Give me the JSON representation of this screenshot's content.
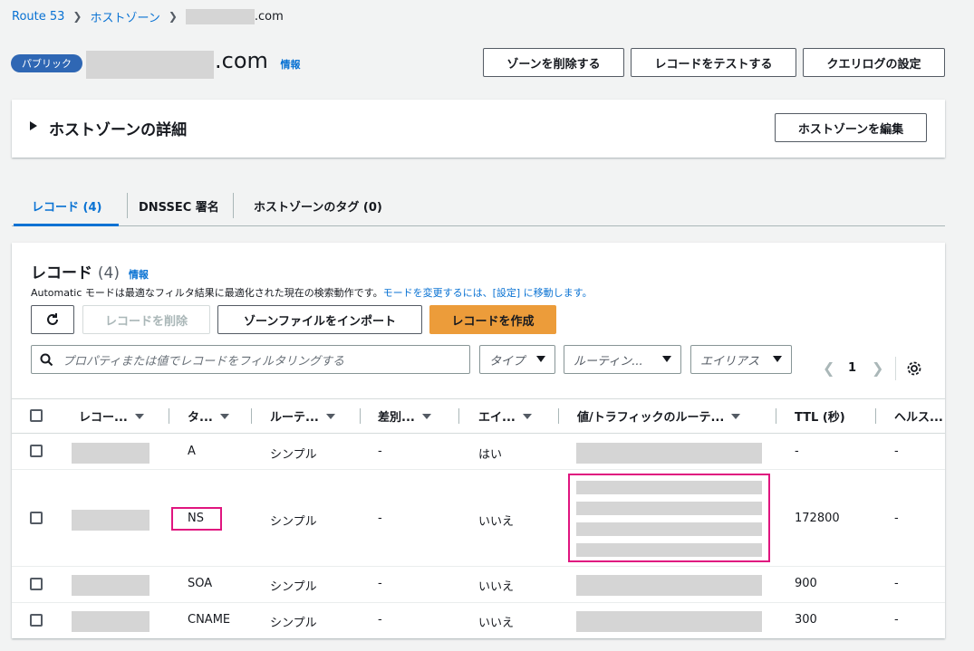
{
  "breadcrumb": {
    "root": "Route 53",
    "zones": "ホストゾーン",
    "current_suffix": ".com"
  },
  "header": {
    "badge": "パブリック",
    "title_suffix": ".com",
    "info": "情報",
    "buttons": {
      "delete_zone": "ゾーンを削除する",
      "test_record": "レコードをテストする",
      "query_log": "クエリログの設定"
    }
  },
  "details": {
    "title": "ホストゾーンの詳細",
    "edit_button": "ホストゾーンを編集"
  },
  "tabs": [
    {
      "label": "レコード (4)",
      "active": true
    },
    {
      "label": "DNSSEC 署名",
      "active": false
    },
    {
      "label": "ホストゾーンのタグ (0)",
      "active": false
    }
  ],
  "records": {
    "title": "レコード",
    "count": "(4)",
    "info": "情報",
    "hint_text": "Automatic モードは最適なフィルタ結果に最適化された現在の検索動作です。",
    "hint_link": "モードを変更するには、[設定] に移動します。",
    "buttons": {
      "delete": "レコードを削除",
      "import": "ゾーンファイルをインポート",
      "create": "レコードを作成"
    },
    "search_placeholder": "プロパティまたは値でレコードをフィルタリングする",
    "filters": {
      "type": "タイプ",
      "routing": "ルーティン...",
      "alias": "エイリアス"
    },
    "page": "1",
    "columns": [
      "レコー...",
      "タ...",
      "ルーテ...",
      "差別...",
      "エイ...",
      "値/トラフィックのルーテ...",
      "TTL (秒)",
      "ヘルス..."
    ],
    "rows": [
      {
        "type": "A",
        "routing": "シンプル",
        "diff": "-",
        "alias": "はい",
        "ttl": "-",
        "health": "-"
      },
      {
        "type": "NS",
        "routing": "シンプル",
        "diff": "-",
        "alias": "いいえ",
        "ttl": "172800",
        "health": "-"
      },
      {
        "type": "SOA",
        "routing": "シンプル",
        "diff": "-",
        "alias": "いいえ",
        "ttl": "900",
        "health": "-"
      },
      {
        "type": "CNAME",
        "routing": "シンプル",
        "diff": "-",
        "alias": "いいえ",
        "ttl": "300",
        "health": "-"
      }
    ]
  },
  "colors": {
    "link": "#0972d3",
    "primary_button": "#ec9c3a",
    "badge": "#2f67b4",
    "highlight": "#e0157f"
  }
}
